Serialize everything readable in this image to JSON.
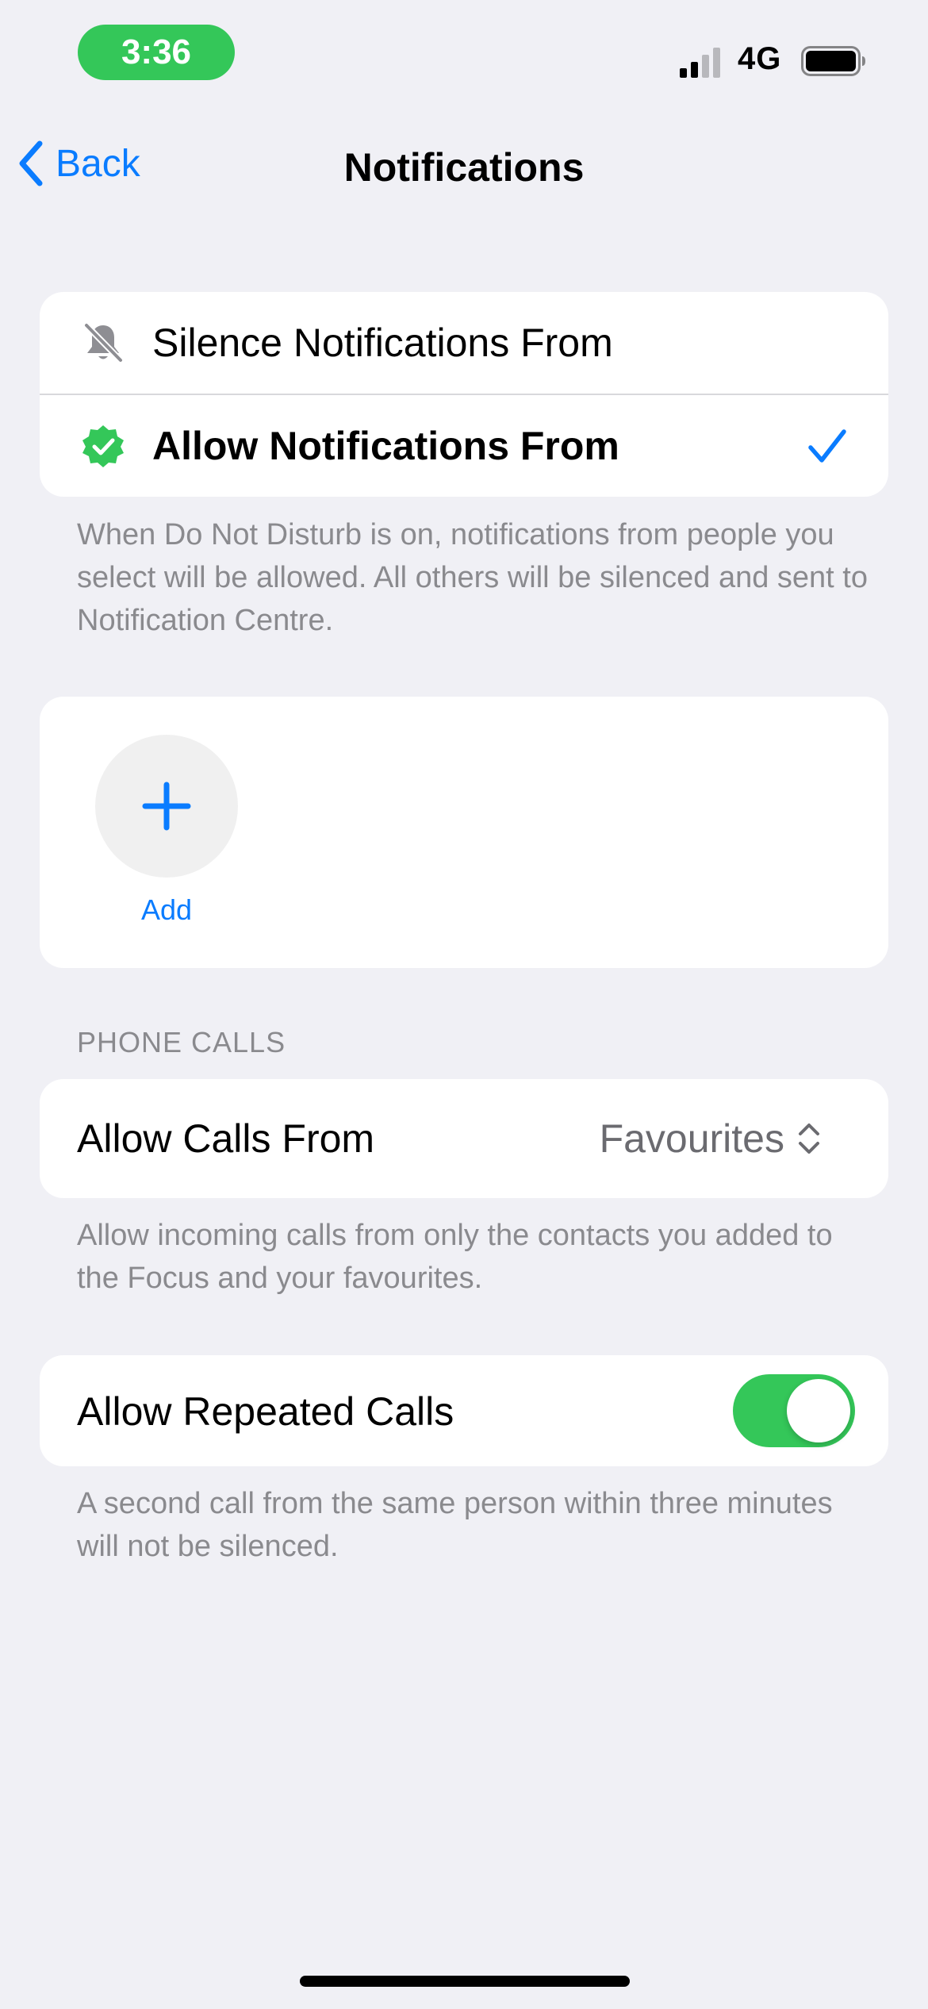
{
  "status_bar": {
    "time": "3:36",
    "network": "4G",
    "time_pill_color": "#34c759"
  },
  "nav": {
    "back_label": "Back",
    "title": "Notifications",
    "accent_color": "#0a7cff"
  },
  "mode_options": [
    {
      "label": "Silence Notifications From",
      "icon": "bell-slash-icon",
      "selected": false
    },
    {
      "label": "Allow Notifications From",
      "icon": "checkmark-seal-icon",
      "selected": true
    }
  ],
  "mode_footnote": "When Do Not Disturb is on, notifications from people you select will be allowed. All others will be silenced and sent to Notification Centre.",
  "people": {
    "add_label": "Add",
    "add_icon": "plus-icon"
  },
  "phone_calls": {
    "section_header": "PHONE CALLS",
    "allow_calls_label": "Allow Calls From",
    "allow_calls_value": "Favourites",
    "allow_calls_footnote": "Allow incoming calls from only the contacts you added to the Focus and your favourites.",
    "repeated_calls_label": "Allow Repeated Calls",
    "repeated_calls_on": true,
    "repeated_calls_footnote": "A second call from the same person within three minutes will not be silenced."
  }
}
